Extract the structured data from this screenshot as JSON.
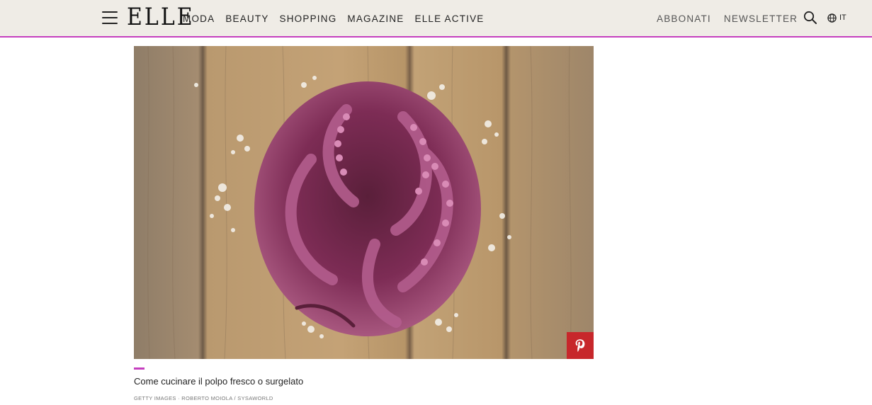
{
  "header": {
    "logo": "ELLE",
    "nav": [
      "MODA",
      "BEAUTY",
      "SHOPPING",
      "MAGAZINE",
      "ELLE ACTIVE"
    ],
    "right_links": [
      "ABBONATI",
      "NEWSLETTER"
    ],
    "language": "IT",
    "icons": {
      "menu": "hamburger-menu-icon",
      "search": "search-icon",
      "language": "globe-icon"
    },
    "accent_color": "#c53fbf"
  },
  "article": {
    "image_alt": "Polpo su tavolo di legno con sale grosso",
    "caption": "Come cucinare il polpo fresco o surgelato",
    "credit": "GETTY IMAGES · ROBERTO MOIOLA / SYSAWORLD",
    "pin_icon": "pinterest-icon",
    "pin_color": "#c7272b"
  }
}
